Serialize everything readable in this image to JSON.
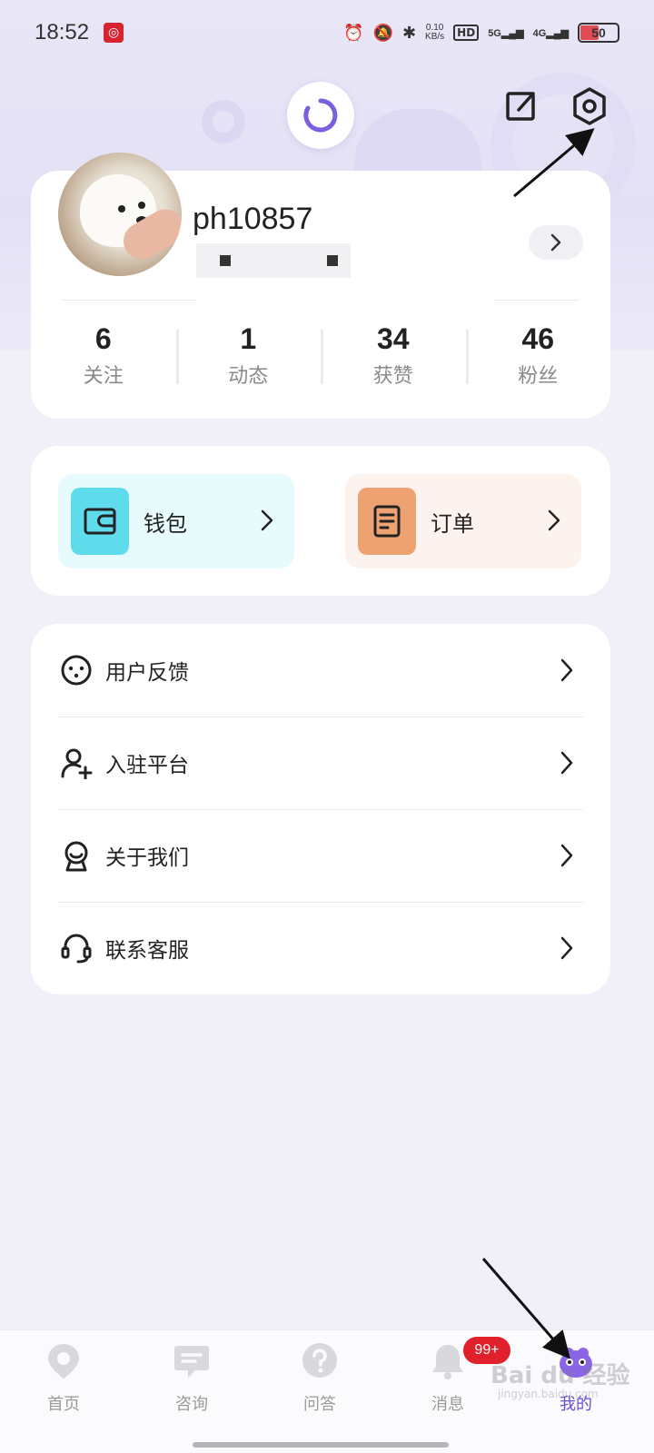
{
  "status_bar": {
    "time": "18:52",
    "net_speed_value": "0.10",
    "net_speed_unit": "KB/s",
    "hd": "HD",
    "sim1": "5G",
    "sim2": "4G",
    "battery": "50"
  },
  "profile": {
    "username": "ph10857",
    "stats": [
      {
        "value": "6",
        "label": "关注"
      },
      {
        "value": "1",
        "label": "动态"
      },
      {
        "value": "34",
        "label": "获赞"
      },
      {
        "value": "46",
        "label": "粉丝"
      }
    ]
  },
  "quick_actions": {
    "wallet": {
      "label": "钱包",
      "icon": "wallet-icon",
      "color": "#5fdcec"
    },
    "orders": {
      "label": "订单",
      "icon": "order-icon",
      "color": "#eea271"
    }
  },
  "menu": [
    {
      "label": "用户反馈",
      "icon": "feedback-icon"
    },
    {
      "label": "入驻平台",
      "icon": "add-user-icon"
    },
    {
      "label": "关于我们",
      "icon": "about-icon"
    },
    {
      "label": "联系客服",
      "icon": "headset-icon"
    }
  ],
  "bottom_nav": {
    "items": [
      {
        "label": "首页",
        "icon": "location-pin-icon"
      },
      {
        "label": "咨询",
        "icon": "chat-icon"
      },
      {
        "label": "问答",
        "icon": "question-icon"
      },
      {
        "label": "消息",
        "icon": "bell-icon"
      },
      {
        "label": "我的",
        "icon": "mascot-icon"
      }
    ],
    "message_badge": "99+",
    "active_color": "#6b4ddb"
  },
  "watermark": {
    "text": "Bai du 经验",
    "sub": "jingyan.baidu.com"
  }
}
